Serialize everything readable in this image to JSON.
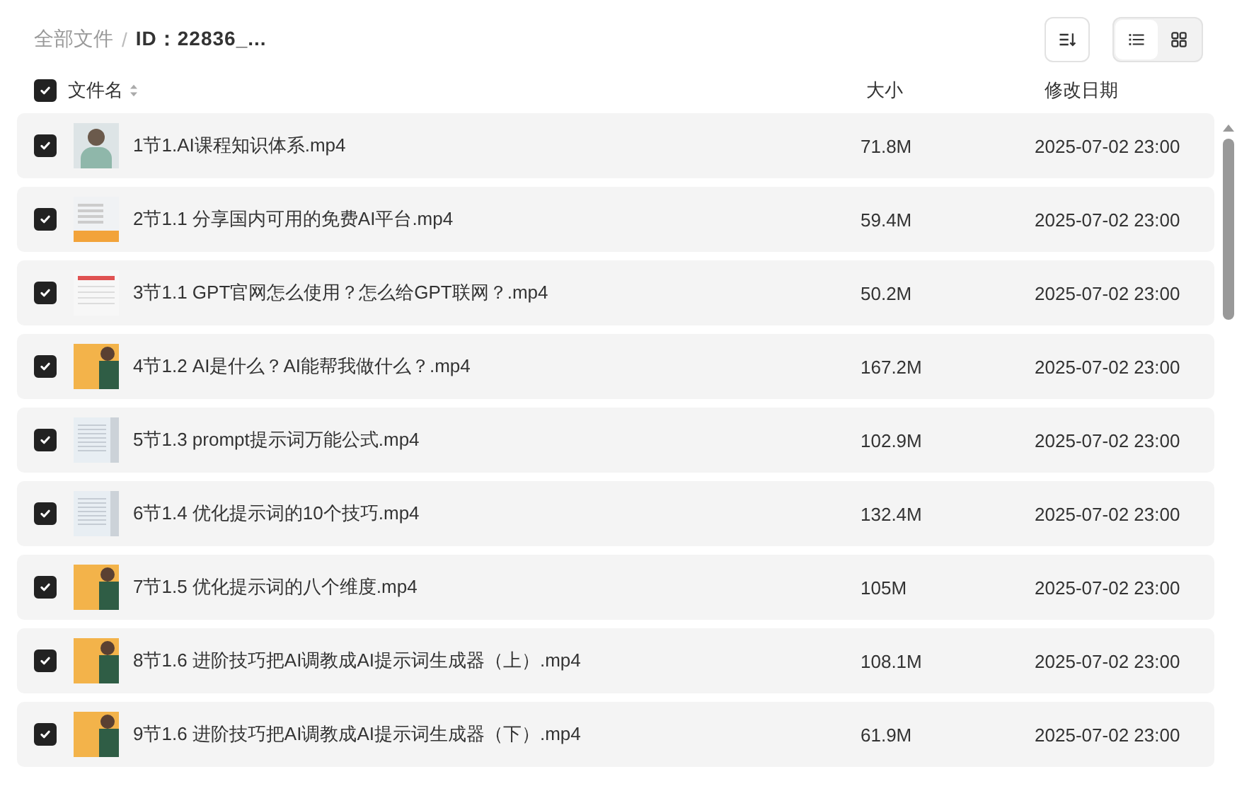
{
  "breadcrumb": {
    "root": "全部文件",
    "separator": "/",
    "current": "ID：22836_..."
  },
  "toolbar": {
    "views": [
      {
        "kind": "list",
        "selected": true
      },
      {
        "kind": "grid",
        "selected": false
      }
    ]
  },
  "table": {
    "all_checked": true,
    "columns": [
      "文件名",
      "大小",
      "修改日期"
    ],
    "rows": [
      {
        "checked": true,
        "kind": "person",
        "name": "1节1.AI课程知识体系.mp4",
        "size": "71.8M",
        "date": "2025-07-02 23:00"
      },
      {
        "checked": true,
        "kind": "slide-orange",
        "name": "2节1.1 分享国内可用的免费AI平台.mp4",
        "size": "59.4M",
        "date": "2025-07-02 23:00"
      },
      {
        "checked": true,
        "kind": "slide-red",
        "name": "3节1.1 GPT官网怎么使用？怎么给GPT联网？.mp4",
        "size": "50.2M",
        "date": "2025-07-02 23:00"
      },
      {
        "checked": true,
        "kind": "poster",
        "name": "4节1.2 AI是什么？AI能帮我做什么？.mp4",
        "size": "167.2M",
        "date": "2025-07-02 23:00"
      },
      {
        "checked": true,
        "kind": "slide",
        "name": "5节1.3 prompt提示词万能公式.mp4",
        "size": "102.9M",
        "date": "2025-07-02 23:00"
      },
      {
        "checked": true,
        "kind": "slide",
        "name": "6节1.4 优化提示词的10个技巧.mp4",
        "size": "132.4M",
        "date": "2025-07-02 23:00"
      },
      {
        "checked": true,
        "kind": "poster",
        "name": "7节1.5 优化提示词的八个维度.mp4",
        "size": "105M",
        "date": "2025-07-02 23:00"
      },
      {
        "checked": true,
        "kind": "poster",
        "name": "8节1.6 进阶技巧把AI调教成AI提示词生成器（上）.mp4",
        "size": "108.1M",
        "date": "2025-07-02 23:00"
      },
      {
        "checked": true,
        "kind": "poster",
        "name": "9节1.6 进阶技巧把AI调教成AI提示词生成器（下）.mp4",
        "size": "61.9M",
        "date": "2025-07-02 23:00"
      }
    ]
  }
}
